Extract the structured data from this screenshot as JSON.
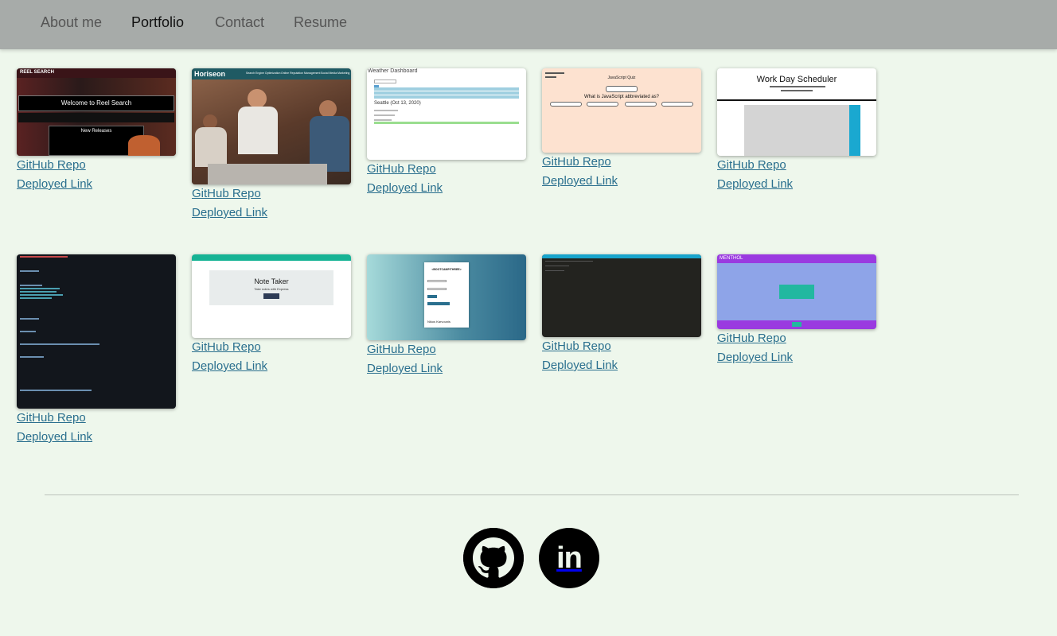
{
  "nav": {
    "items": [
      {
        "label": "About me"
      },
      {
        "label": "Portfolio"
      },
      {
        "label": "Contact"
      },
      {
        "label": "Resume"
      }
    ]
  },
  "projects": {
    "repo_label": "GitHub Repo",
    "deploy_label": "Deployed Link",
    "reel": {
      "logo": "REEL SEARCH",
      "heading": "Welcome to Reel Search",
      "sub": "New Releases"
    },
    "horiseon": {
      "logo": "Horiseon",
      "nav": [
        "Search Engine Optimization",
        "Online Reputation Management",
        "Social Media Marketing"
      ]
    },
    "weather": {
      "title": "Weather Dashboard",
      "city": "Seattle (Oct 13, 2020)"
    },
    "quiz": {
      "title": "JavaScript Quiz",
      "question": "What is JavaScript abbreviated as?"
    },
    "scheduler": {
      "title": "Work Day Scheduler"
    },
    "note": {
      "title": "Note Taker",
      "sub": "Take notes with Express"
    },
    "bootcamp": {
      "brand": "<BOOTCAMP/THREE>",
      "name": "Nikos Karvounis"
    },
    "menthol": {
      "brand": "MENTHOL"
    }
  },
  "footer": {
    "github_icon": "github-icon",
    "linkedin_icon": "linkedin-icon",
    "linkedin_text": "in"
  }
}
